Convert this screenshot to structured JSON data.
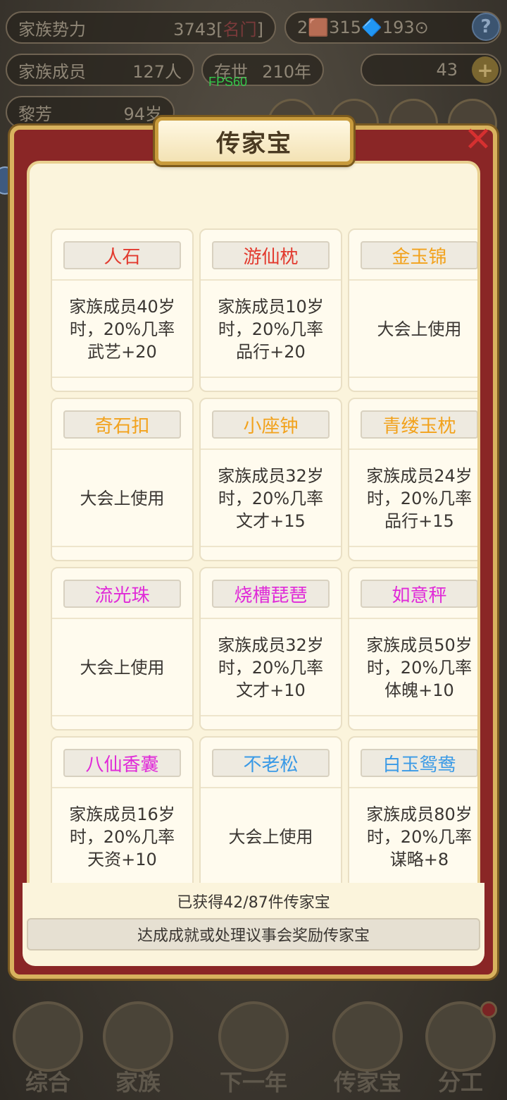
{
  "hud": {
    "power_label": "家族势力",
    "power_value": "3743[",
    "power_rank": "名门",
    "power_close": "]",
    "members_label": "家族成员",
    "members_value": "127人",
    "years_label": "存世",
    "years_value": "210年",
    "person_name": "黎芳",
    "person_age": "94岁",
    "currency_text": "2🟫315🔷193⊙",
    "gold_value": "43",
    "fps": "FPS60",
    "help_icon": "?",
    "plus_icon": "+"
  },
  "modal": {
    "title": "传家宝",
    "close_icon": "✕",
    "items": [
      {
        "name": "人石",
        "color": "#e23a2e",
        "desc": "家族成员40岁\n时，20%几率\n武艺+20"
      },
      {
        "name": "游仙枕",
        "color": "#e23a2e",
        "desc": "家族成员10岁\n时，20%几率\n品行+20"
      },
      {
        "name": "金玉锦",
        "color": "#f2a21c",
        "desc": "大会上使用"
      },
      {
        "name": "奇石扣",
        "color": "#f2a21c",
        "desc": "大会上使用"
      },
      {
        "name": "小座钟",
        "color": "#f2a21c",
        "desc": "家族成员32岁\n时，20%几率\n文才+15"
      },
      {
        "name": "青缕玉枕",
        "color": "#f2a21c",
        "desc": "家族成员24岁\n时，20%几率\n品行+15"
      },
      {
        "name": "流光珠",
        "color": "#e02ad8",
        "desc": "大会上使用"
      },
      {
        "name": "烧槽琵琶",
        "color": "#e02ad8",
        "desc": "家族成员32岁\n时，20%几率\n文才+10"
      },
      {
        "name": "如意秤",
        "color": "#e02ad8",
        "desc": "家族成员50岁\n时，20%几率\n体魄+10"
      },
      {
        "name": "八仙香囊",
        "color": "#e02ad8",
        "desc": "家族成员16岁\n时，20%几率\n天资+10"
      },
      {
        "name": "不老松",
        "color": "#3a9ae6",
        "desc": "大会上使用"
      },
      {
        "name": "白玉鸳鸯",
        "color": "#3a9ae6",
        "desc": "家族成员80岁\n时，20%几率\n谋略+8"
      }
    ],
    "progress": "已获得42/87件传家宝",
    "reward_hint": "达成成就或处理议事会奖励传家宝"
  },
  "nav": [
    {
      "label": "综合"
    },
    {
      "label": "家族"
    },
    {
      "label": "下一年"
    },
    {
      "label": "传家宝"
    },
    {
      "label": "分工"
    }
  ]
}
